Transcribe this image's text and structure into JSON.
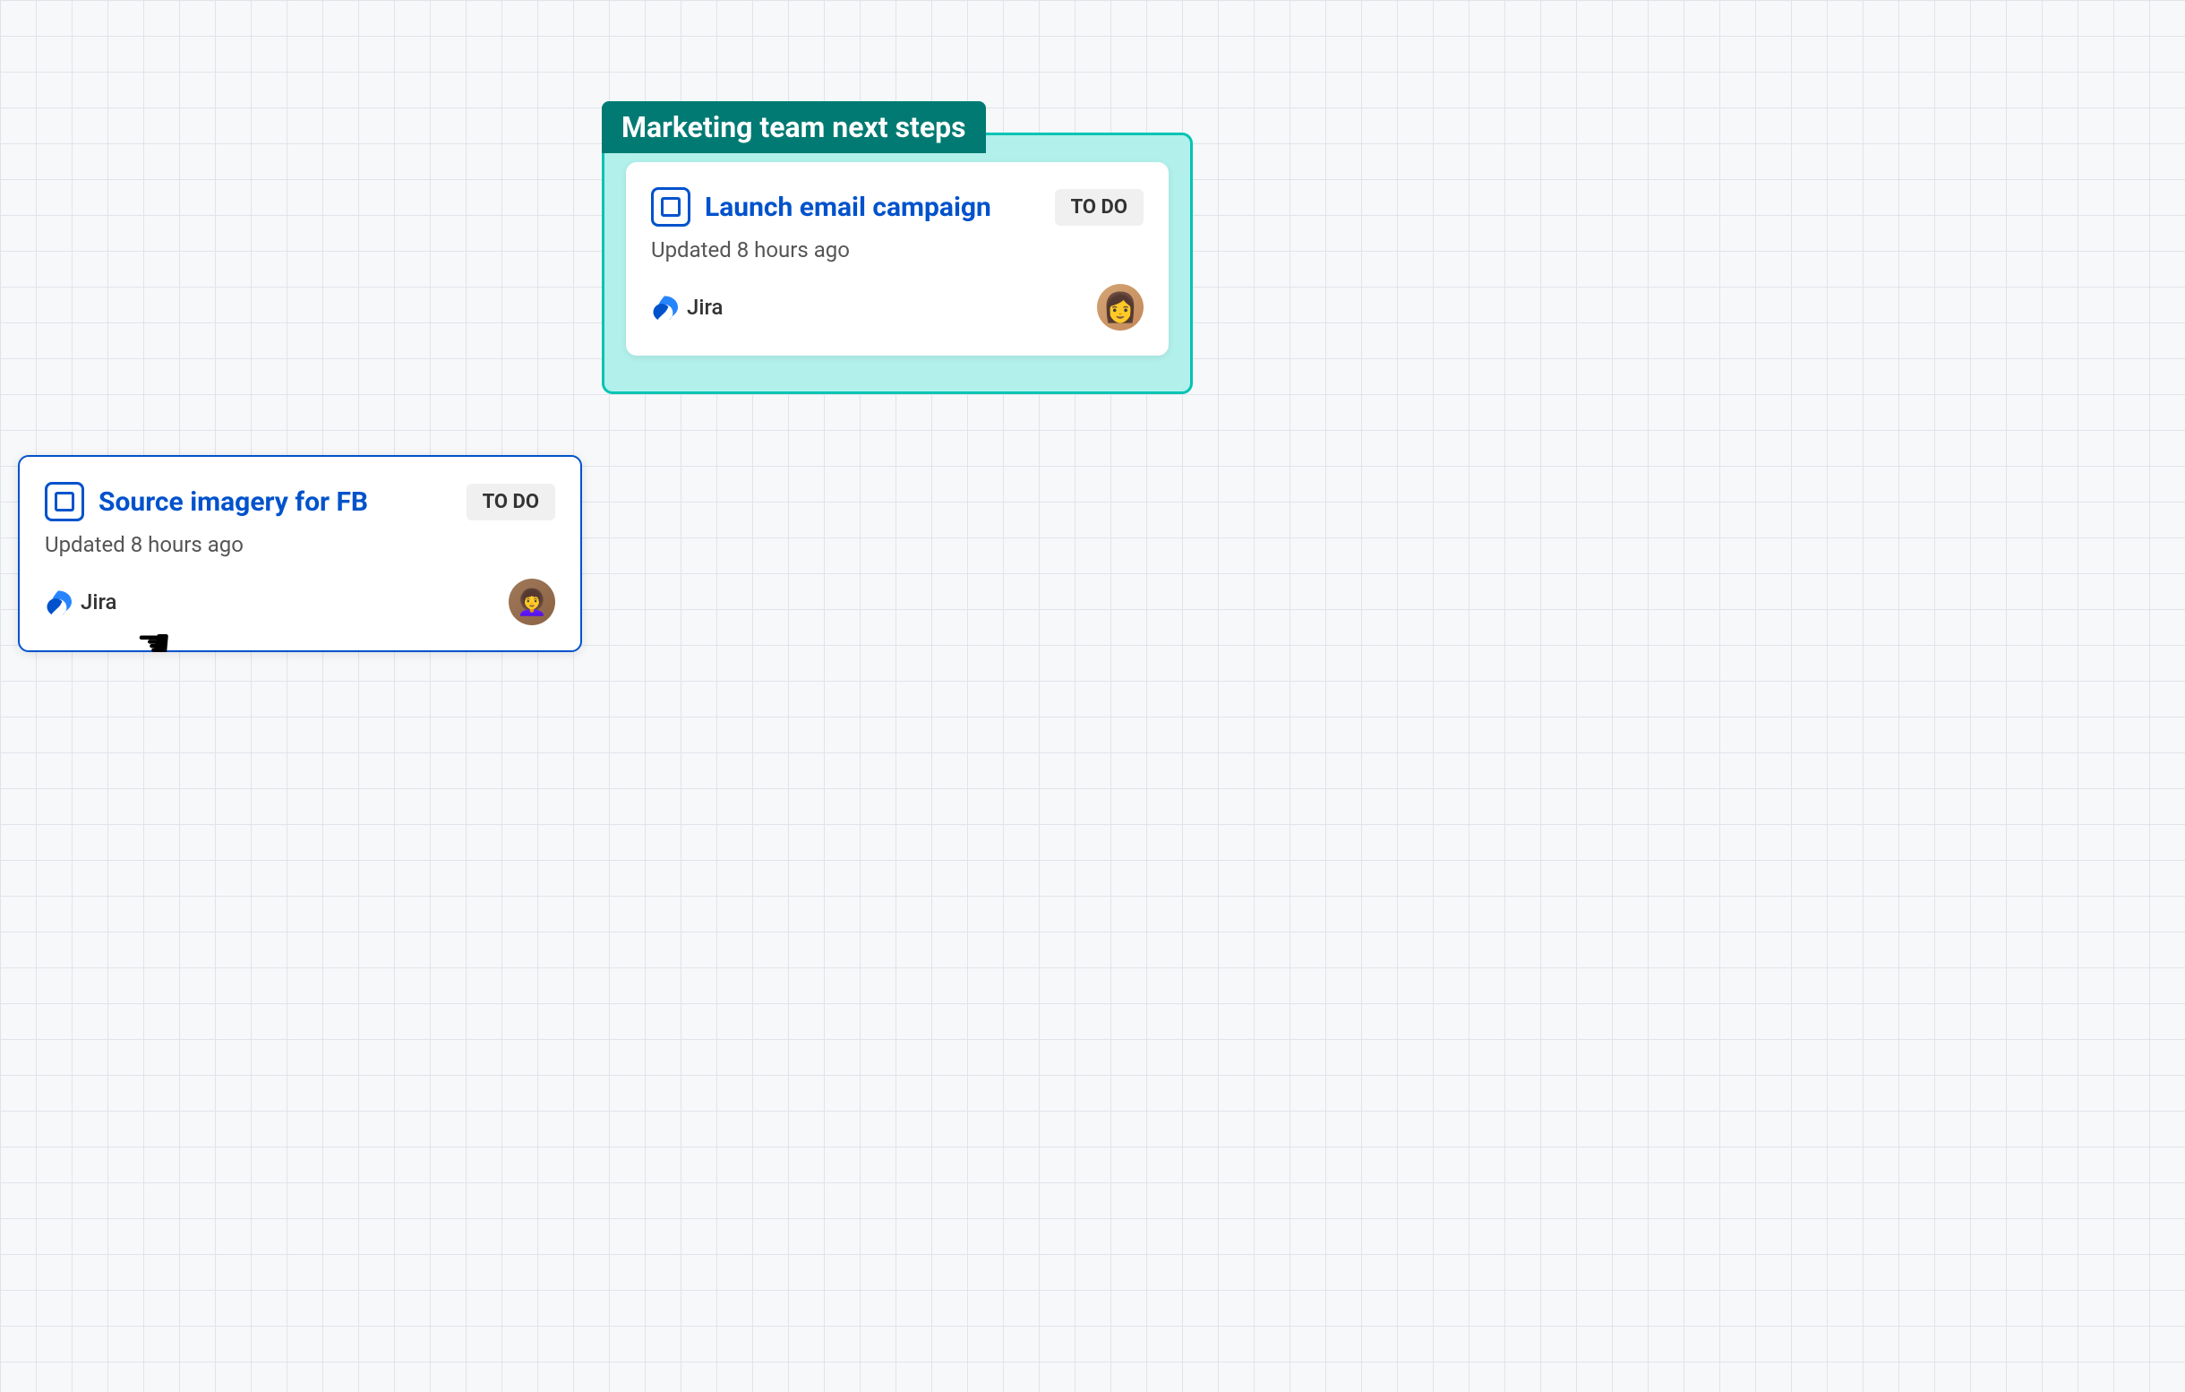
{
  "group": {
    "label": "Marketing team next steps",
    "border_color": "#00c4b4",
    "bg_color": "#b2f0eb",
    "label_bg": "#007a73"
  },
  "cards": [
    {
      "id": "launch-email",
      "title": "Launch email campaign",
      "status": "TO DO",
      "updated": "Updated 8 hours ago",
      "source": "Jira",
      "in_group": true,
      "avatar_label": "Asian woman avatar"
    },
    {
      "id": "source-imagery",
      "title": "Source imagery for FB",
      "status": "TO DO",
      "updated": "Updated 8 hours ago",
      "source": "Jira",
      "in_group": false,
      "avatar_label": "Glasses woman avatar"
    }
  ],
  "cursor": "☚"
}
